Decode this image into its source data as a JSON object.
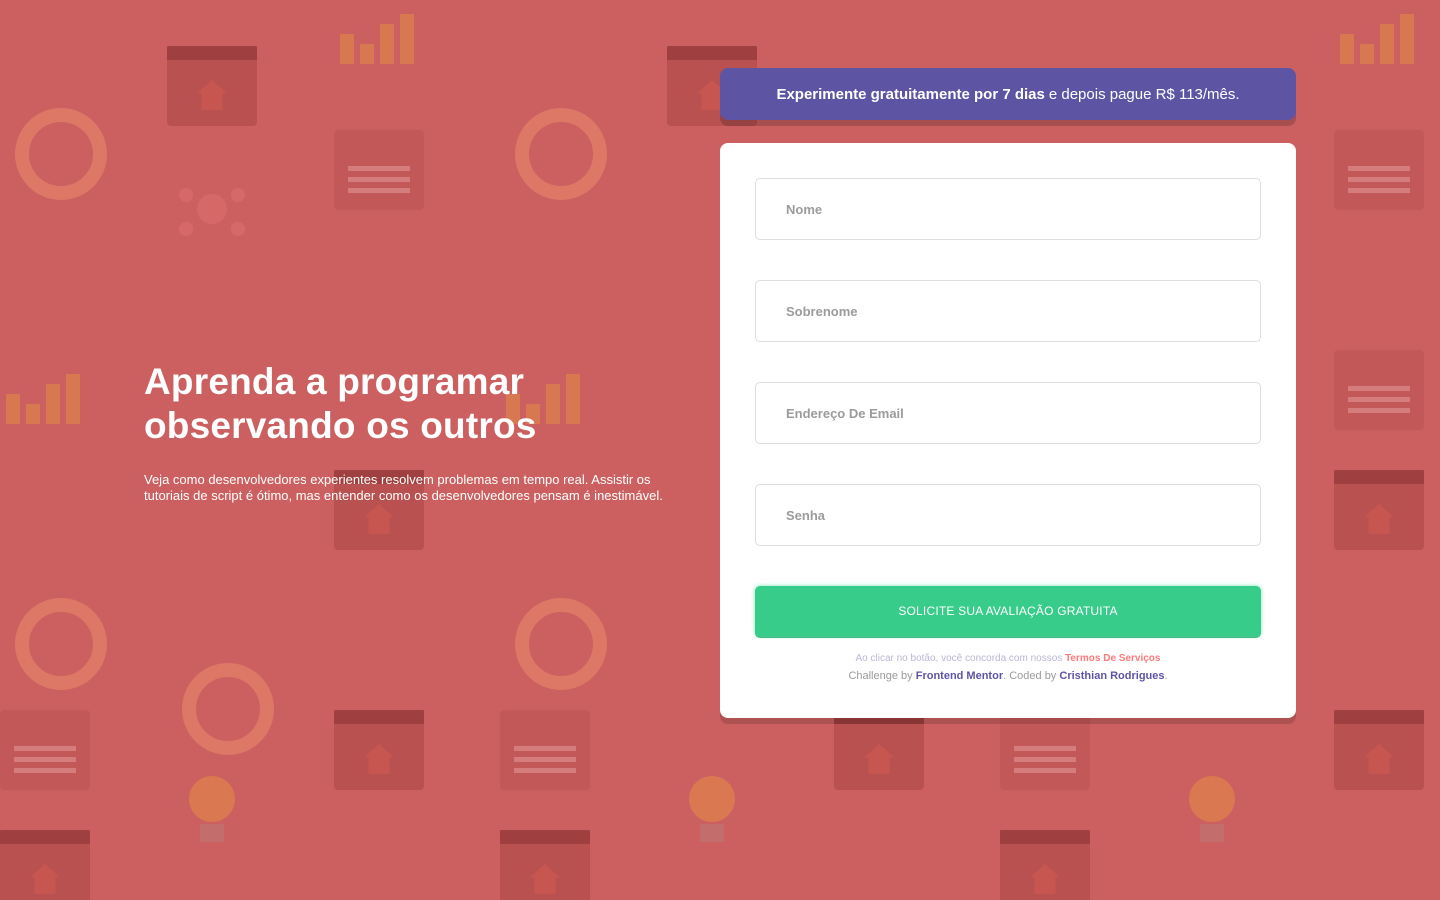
{
  "colors": {
    "background": "#cc6060",
    "promo_bg": "#5e54a4",
    "cta_bg": "#38cc8b",
    "terms_link": "#ff7a7a",
    "credit_link": "#5e54a4"
  },
  "hero": {
    "title_line1": "Aprenda a programar",
    "title_line2": "observando os outros",
    "description": "Veja como desenvolvedores experientes resolvem problemas em tempo real. Assistir os tutoriais de script é ótimo, mas entender como os desenvolvedores pensam é inestimável."
  },
  "promo": {
    "bold": "Experimente gratuitamente por 7 dias",
    "rest": "e depois pague R$ 113/mês."
  },
  "form": {
    "first_name": {
      "placeholder": "Nome",
      "value": ""
    },
    "last_name": {
      "placeholder": "Sobrenome",
      "value": ""
    },
    "email": {
      "placeholder": "Endereço De Email",
      "value": ""
    },
    "password": {
      "placeholder": "Senha",
      "value": ""
    },
    "submit_label": "SOLICITE SUA AVALIAÇÃO GRATUITA"
  },
  "terms": {
    "prefix": "Ao clicar no botão, você concorda com nossos",
    "link": "Termos De Serviços"
  },
  "credit": {
    "challenge_by": "Challenge by",
    "challenge_link": "Frontend Mentor",
    "coded_by": ". Coded by",
    "coder_link": "Cristhian Rodrigues",
    "suffix": "."
  }
}
